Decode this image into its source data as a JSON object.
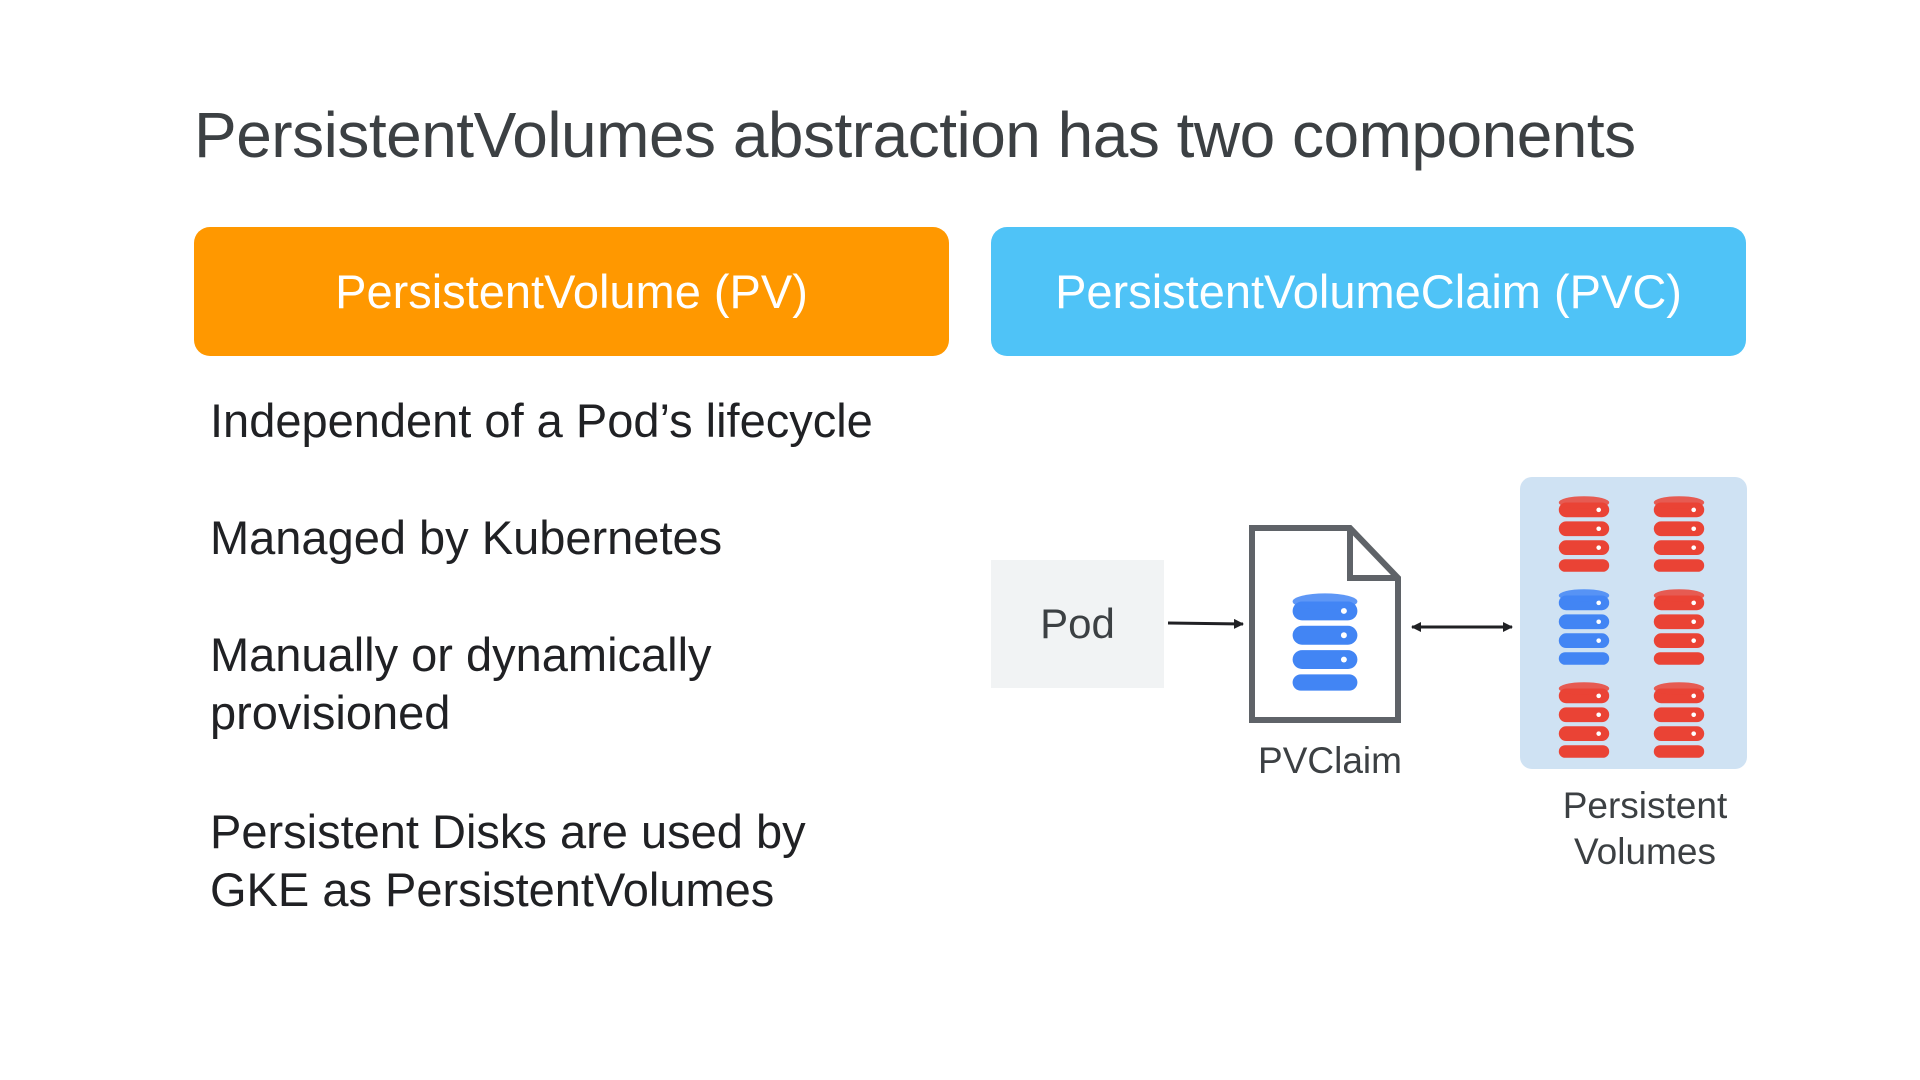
{
  "title": "PersistentVolumes abstraction has two components",
  "pv_header": "PersistentVolume (PV)",
  "pvc_header": "PersistentVolumeClaim (PVC)",
  "bullets": [
    "Independent of a Pod’s lifecycle",
    "Managed by Kubernetes",
    "Manually or dynamically provisioned",
    "Persistent Disks are used by GKE as PersistentVolumes"
  ],
  "diagram": {
    "pod_label": "Pod",
    "pvclaim_label": "PVClaim",
    "pvs_label": "Persistent Volumes"
  },
  "colors": {
    "pv_orange": "#ff9800",
    "pvc_blue": "#4fc3f7",
    "db_blue": "#4285f4",
    "db_red": "#ea4335",
    "panel": "#cfe2f3"
  }
}
